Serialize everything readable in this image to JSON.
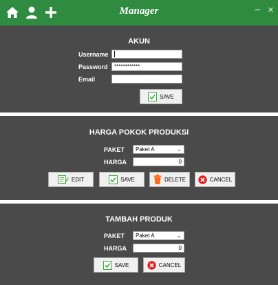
{
  "window": {
    "title": "Manager",
    "minimize": "−",
    "close": "×"
  },
  "akun": {
    "heading": "AKUN",
    "username_label": "Username",
    "password_label": "Password",
    "email_label": "Email",
    "username_value": "",
    "password_value": "************",
    "email_value": "",
    "save_label": "SAVE"
  },
  "hpp": {
    "heading": "HARGA POKOK PRODUKSI",
    "paket_label": "PAKET",
    "paket_value": "Paket A",
    "harga_label": "HARGA",
    "harga_value": "0",
    "edit_label": "EDIT",
    "save_label": "SAVE",
    "delete_label": "DELETE",
    "cancel_label": "CANCEL"
  },
  "tambah": {
    "heading": "TAMBAH PRODUK",
    "paket_label": "PAKET",
    "paket_value": "Paket A",
    "harga_label": "HARGA",
    "harga_value": "0",
    "save_label": "SAVE",
    "cancel_label": "CANCEL"
  },
  "colors": {
    "titlebar": "#2e8b3f",
    "panel": "#4a4a4a",
    "save_icon": "#3aa83a",
    "delete_icon": "#ff6a1a",
    "cancel_icon": "#e02020"
  }
}
